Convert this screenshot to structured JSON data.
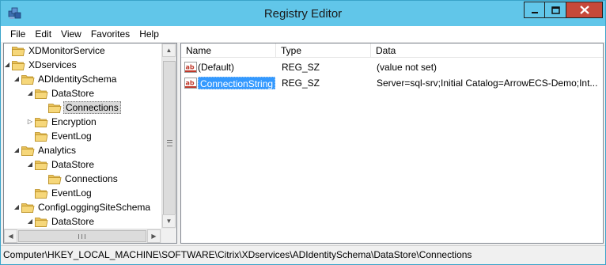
{
  "window": {
    "title": "Registry Editor"
  },
  "menu": [
    "File",
    "Edit",
    "View",
    "Favorites",
    "Help"
  ],
  "tree": {
    "items": [
      {
        "label": "XDMonitorService",
        "indent": 0,
        "expander": "none",
        "selected": false
      },
      {
        "label": "XDservices",
        "indent": 0,
        "expander": "open",
        "selected": false
      },
      {
        "label": "ADIdentitySchema",
        "indent": 1,
        "expander": "open",
        "selected": false
      },
      {
        "label": "DataStore",
        "indent": 2,
        "expander": "open",
        "selected": false
      },
      {
        "label": "Connections",
        "indent": 3,
        "expander": "none",
        "selected": true
      },
      {
        "label": "Encryption",
        "indent": 2,
        "expander": "closed",
        "selected": false
      },
      {
        "label": "EventLog",
        "indent": 2,
        "expander": "none",
        "selected": false
      },
      {
        "label": "Analytics",
        "indent": 1,
        "expander": "open",
        "selected": false
      },
      {
        "label": "DataStore",
        "indent": 2,
        "expander": "open",
        "selected": false
      },
      {
        "label": "Connections",
        "indent": 3,
        "expander": "none",
        "selected": false
      },
      {
        "label": "EventLog",
        "indent": 2,
        "expander": "none",
        "selected": false
      },
      {
        "label": "ConfigLoggingSiteSchema",
        "indent": 1,
        "expander": "open",
        "selected": false
      },
      {
        "label": "DataStore",
        "indent": 2,
        "expander": "open",
        "selected": false
      }
    ],
    "scroll_grip": "III"
  },
  "list": {
    "columns": [
      "Name",
      "Type",
      "Data"
    ],
    "rows": [
      {
        "name": "(Default)",
        "type": "REG_SZ",
        "data": "(value not set)",
        "selected": false,
        "icon": "string-value-icon"
      },
      {
        "name": "ConnectionString",
        "type": "REG_SZ",
        "data": "Server=sql-srv;Initial Catalog=ArrowECS-Demo;Int...",
        "selected": true,
        "icon": "string-value-icon"
      }
    ]
  },
  "status": {
    "path": "Computer\\HKEY_LOCAL_MACHINE\\SOFTWARE\\Citrix\\XDservices\\ADIdentitySchema\\DataStore\\Connections"
  },
  "colors": {
    "titlebar": "#61c6e9",
    "close_button": "#c7493a",
    "selection": "#3399ff",
    "folder": "#e8c15a"
  }
}
